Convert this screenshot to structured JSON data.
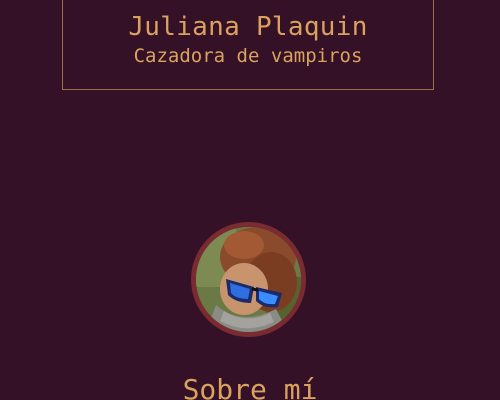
{
  "header": {
    "name": "Juliana Plaquin",
    "tagline": "Cazadora de vampiros"
  },
  "profile": {
    "avatar_icon": "profile-photo-person-with-blue-sunglasses",
    "ring_color": "#7a2a31"
  },
  "sections": {
    "about_title": "Sobre mí"
  },
  "colors": {
    "background": "#341126",
    "accent": "#d9a25e",
    "border": "#9b7047"
  }
}
